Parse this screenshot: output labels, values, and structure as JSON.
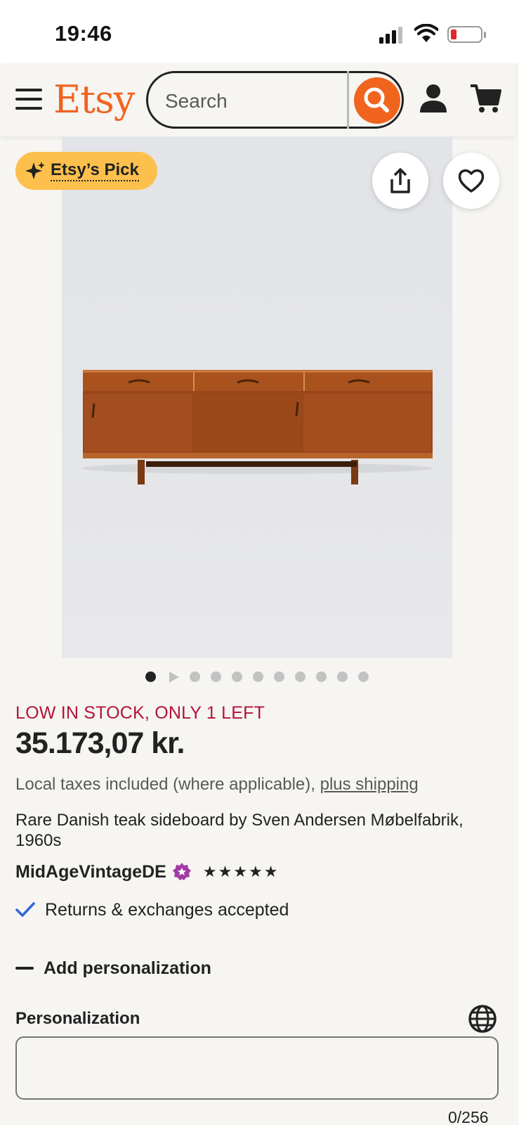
{
  "status_bar": {
    "time": "19:46"
  },
  "header": {
    "logo": "Etsy",
    "search": {
      "placeholder": "Search",
      "value": ""
    }
  },
  "badge": {
    "label": "Etsy’s Pick"
  },
  "carousel": {
    "total": 11,
    "active_index": 0,
    "video_index": 1
  },
  "product": {
    "stock_notice": "LOW IN STOCK, ONLY 1 LEFT",
    "price": "35.173,07 kr.",
    "taxes_text": "Local taxes included (where applicable), ",
    "shipping_link": "plus shipping",
    "title": "Rare Danish teak sideboard by Sven Andersen Møbelfabrik, 1960s",
    "shop_name": "MidAgeVintageDE",
    "rating_stars": "★★★★★",
    "returns": "Returns & exchanges accepted"
  },
  "personalization": {
    "toggle_label": "Add personalization",
    "field_label": "Personalization",
    "value": "",
    "counter": "0/256"
  },
  "colors": {
    "brand": "#f1641e",
    "stock_red": "#b5123a",
    "badge_yellow": "#fdc04d",
    "star_seller_purple": "#a23aa3",
    "check_blue": "#2f66d8"
  }
}
